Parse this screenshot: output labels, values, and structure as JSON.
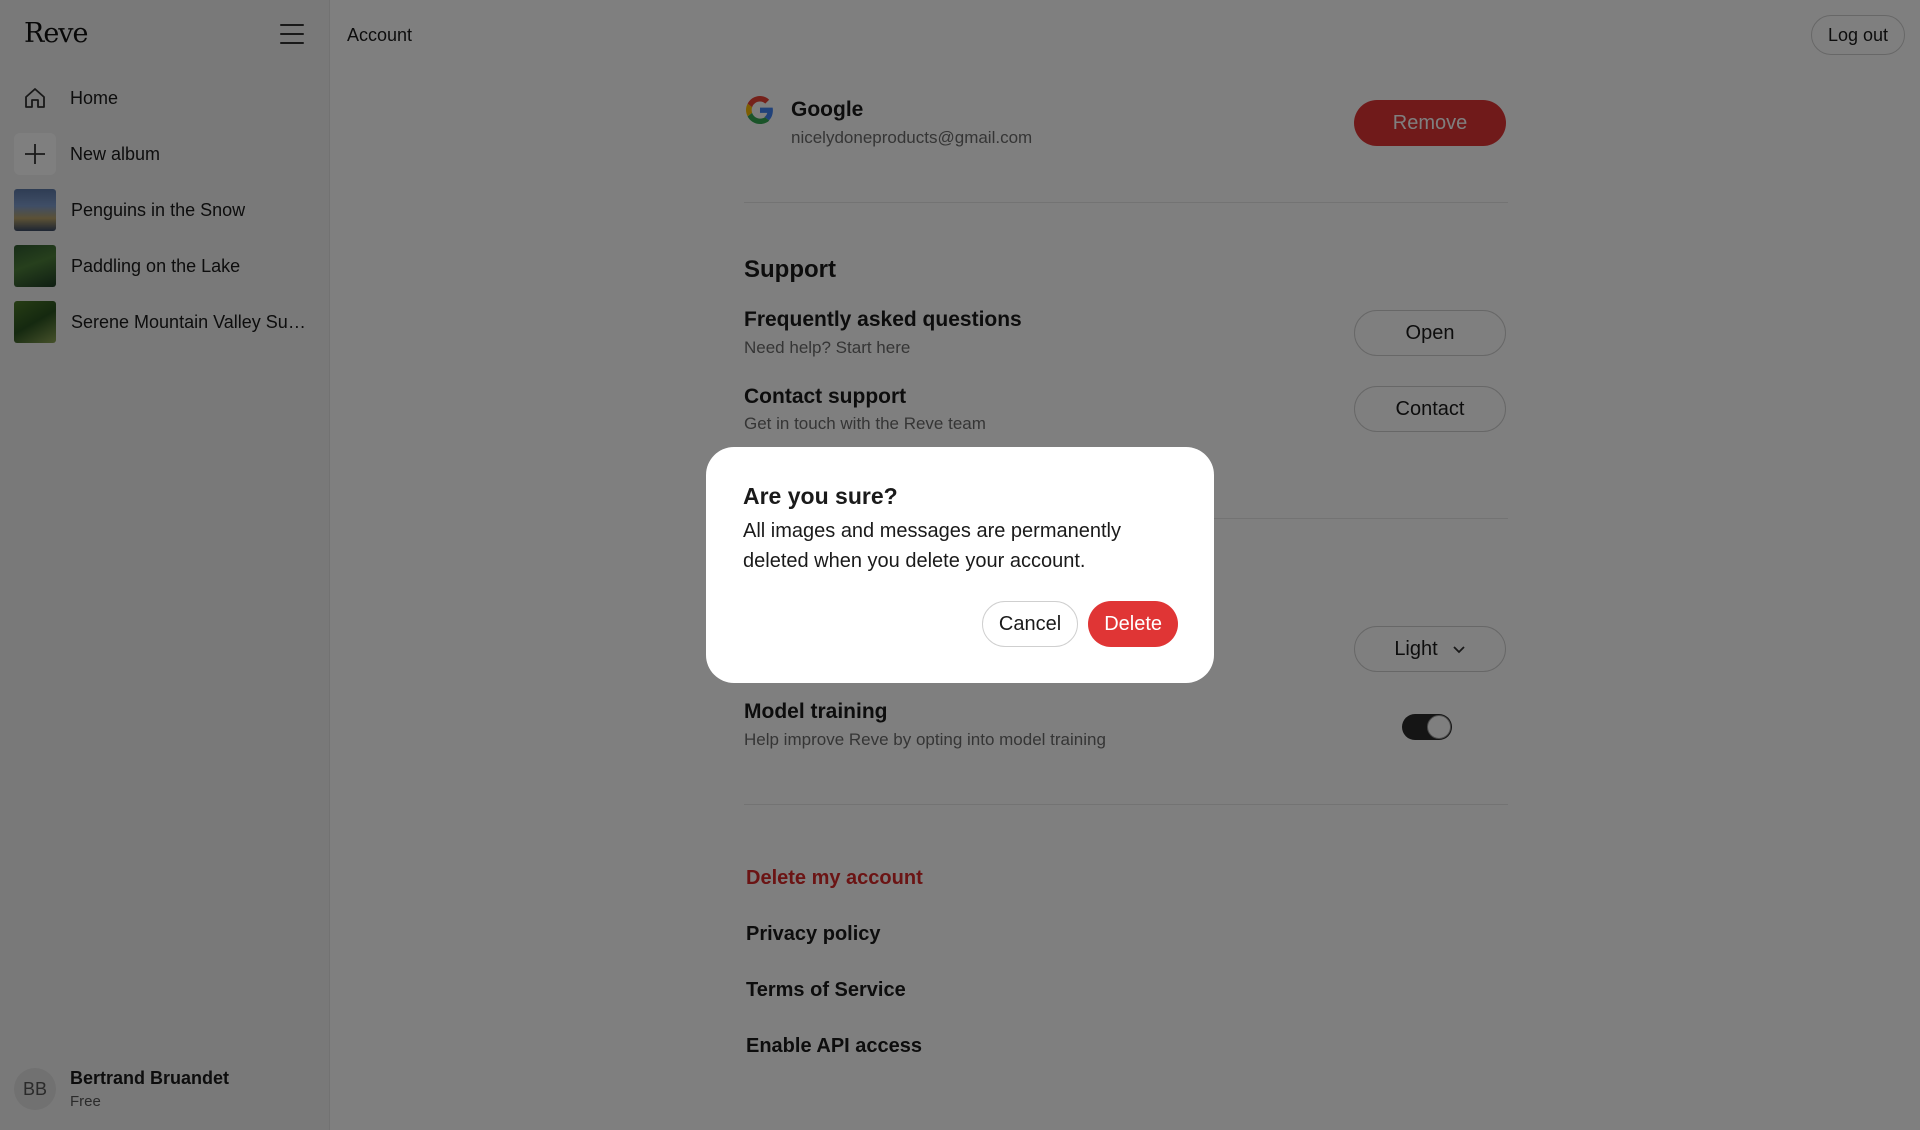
{
  "app": {
    "brand": "Reve",
    "page_title": "Account",
    "logout_label": "Log out"
  },
  "sidebar": {
    "items": [
      {
        "label": "Home",
        "icon": "home-icon"
      },
      {
        "label": "New album",
        "icon": "plus-icon"
      },
      {
        "label": "Penguins in the Snow",
        "icon": "album-thumbnail"
      },
      {
        "label": "Paddling on the Lake",
        "icon": "album-thumbnail"
      },
      {
        "label": "Serene Mountain Valley Sunrise",
        "icon": "album-thumbnail"
      }
    ],
    "user": {
      "initials": "BB",
      "name": "Bertrand Bruandet",
      "plan": "Free"
    }
  },
  "account": {
    "provider": "Google",
    "email": "nicelydoneproducts@gmail.com",
    "remove_label": "Remove"
  },
  "support": {
    "title": "Support",
    "faq": {
      "title": "Frequently asked questions",
      "subtitle": "Need help? Start here",
      "button": "Open"
    },
    "contact": {
      "title": "Contact support",
      "subtitle": "Get in touch with the Reve team",
      "button": "Contact"
    }
  },
  "preferences": {
    "theme_value": "Light",
    "model_training": {
      "title": "Model training",
      "subtitle": "Help improve Reve by opting into model training",
      "enabled": true
    }
  },
  "links": {
    "delete_account": "Delete my account",
    "privacy": "Privacy policy",
    "terms": "Terms of Service",
    "api": "Enable API access"
  },
  "dialog": {
    "title": "Are you sure?",
    "body": "All images and messages are permanently deleted when you delete your account.",
    "cancel_label": "Cancel",
    "delete_label": "Delete"
  },
  "colors": {
    "danger": "#e03535",
    "overlay": "rgba(0,0,0,0.5)"
  }
}
